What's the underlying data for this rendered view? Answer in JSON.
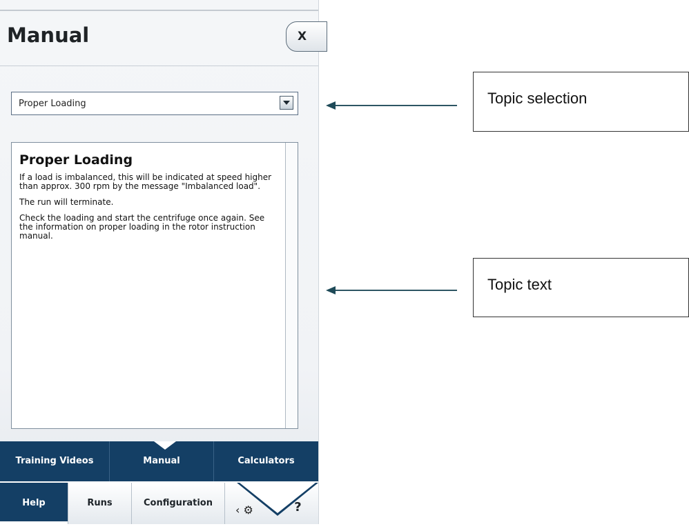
{
  "dialog": {
    "title": "Manual",
    "close_label": "X"
  },
  "topic_select": {
    "selected": "Proper Loading"
  },
  "topic_text": {
    "heading": "Proper Loading",
    "paragraphs": [
      "If a load is imbalanced, this will be indicated at speed higher than approx. 300 rpm by the message \"Imbalanced load\".",
      "The run will terminate.",
      "Check the loading and start the centrifuge once again. See the information on proper loading in the rotor instruction manual."
    ]
  },
  "tabs": [
    {
      "label": "Training Videos"
    },
    {
      "label": "Manual"
    },
    {
      "label": "Calculators"
    }
  ],
  "nav": {
    "help": "Help",
    "runs": "Runs",
    "configuration": "Configuration",
    "tools_glyph": "‹ ⚙",
    "question": "?"
  },
  "callouts": {
    "topic_selection": "Topic selection",
    "topic_text": "Topic text"
  },
  "colors": {
    "tab_background": "#143f65",
    "arrow": "#1e4a58"
  }
}
